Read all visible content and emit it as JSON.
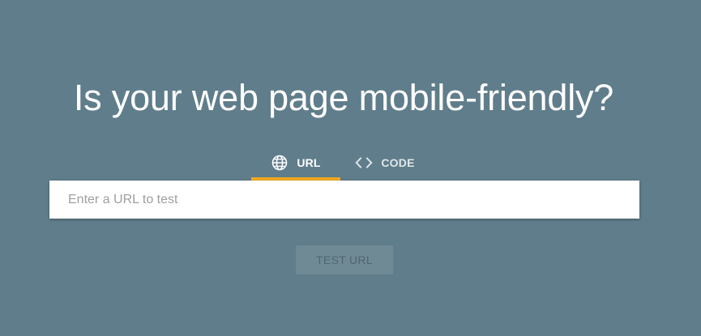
{
  "headline": "Is your web page mobile-friendly?",
  "tabs": [
    {
      "label": "URL",
      "icon": "globe-icon",
      "selected": true
    },
    {
      "label": "CODE",
      "icon": "code-icon",
      "selected": false
    }
  ],
  "url_input": {
    "value": "",
    "placeholder": "Enter a URL to test"
  },
  "test_button": {
    "label": "TEST URL",
    "enabled": false
  },
  "colors": {
    "background": "#607d8b",
    "tab_indicator": "#f4a821",
    "input_background": "#ffffff",
    "button_background_disabled": "#6f8995",
    "button_text_disabled": "#4f6672"
  }
}
